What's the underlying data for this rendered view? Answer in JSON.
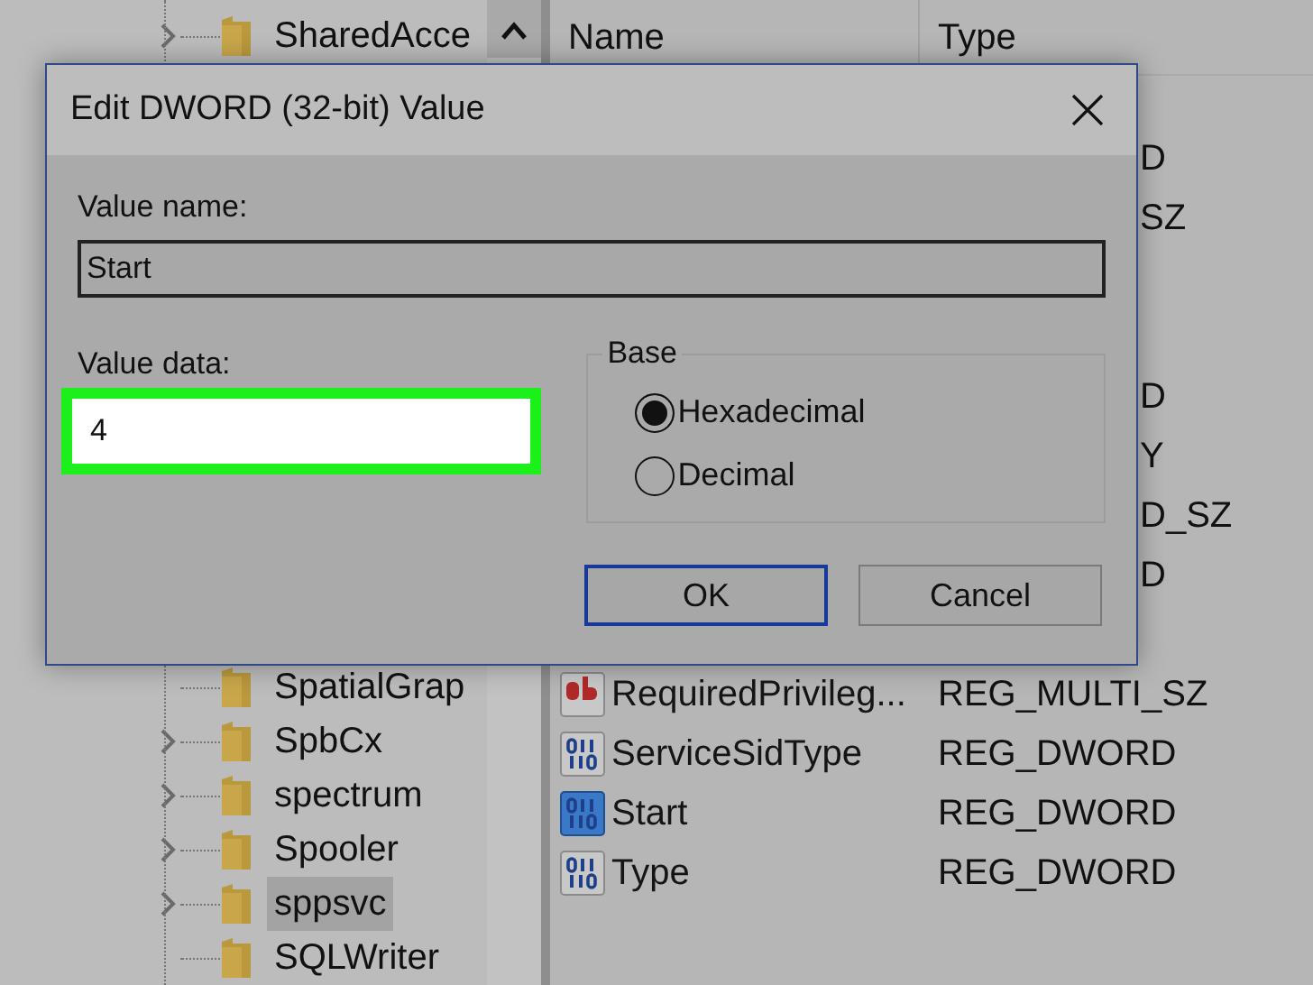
{
  "tree": {
    "items": [
      {
        "label": "SharedAcce",
        "expandable": true,
        "selected": false
      },
      {
        "label": "SpatialGrap",
        "expandable": false,
        "selected": false
      },
      {
        "label": "SpbCx",
        "expandable": true,
        "selected": false
      },
      {
        "label": "spectrum",
        "expandable": true,
        "selected": false
      },
      {
        "label": "Spooler",
        "expandable": true,
        "selected": false
      },
      {
        "label": "sppsvc",
        "expandable": true,
        "selected": true
      },
      {
        "label": "SQLWriter",
        "expandable": false,
        "selected": false
      }
    ]
  },
  "values": {
    "columns": [
      "Name",
      "Type"
    ],
    "covered_types": [
      [
        "D",
        "SZ"
      ],
      [
        "D",
        "Y",
        "D_SZ",
        "D"
      ]
    ],
    "rows": [
      {
        "kind": "string",
        "name": "RequiredPrivileg...",
        "type": "REG_MULTI_SZ",
        "selected": false
      },
      {
        "kind": "dword",
        "name": "ServiceSidType",
        "type": "REG_DWORD",
        "selected": false
      },
      {
        "kind": "dword",
        "name": "Start",
        "type": "REG_DWORD",
        "selected": true
      },
      {
        "kind": "dword",
        "name": "Type",
        "type": "REG_DWORD",
        "selected": false
      }
    ]
  },
  "dialog": {
    "title": "Edit DWORD (32-bit) Value",
    "value_name_label": "Value name:",
    "value_name": "Start",
    "value_data_label": "Value data:",
    "value_data": "4",
    "value_data_highlighted": true,
    "base_label": "Base",
    "base_options": [
      {
        "label": "Hexadecimal",
        "selected": true
      },
      {
        "label": "Decimal",
        "selected": false
      }
    ],
    "buttons": [
      {
        "label": "OK",
        "default": true
      },
      {
        "label": "Cancel",
        "default": false
      }
    ]
  }
}
